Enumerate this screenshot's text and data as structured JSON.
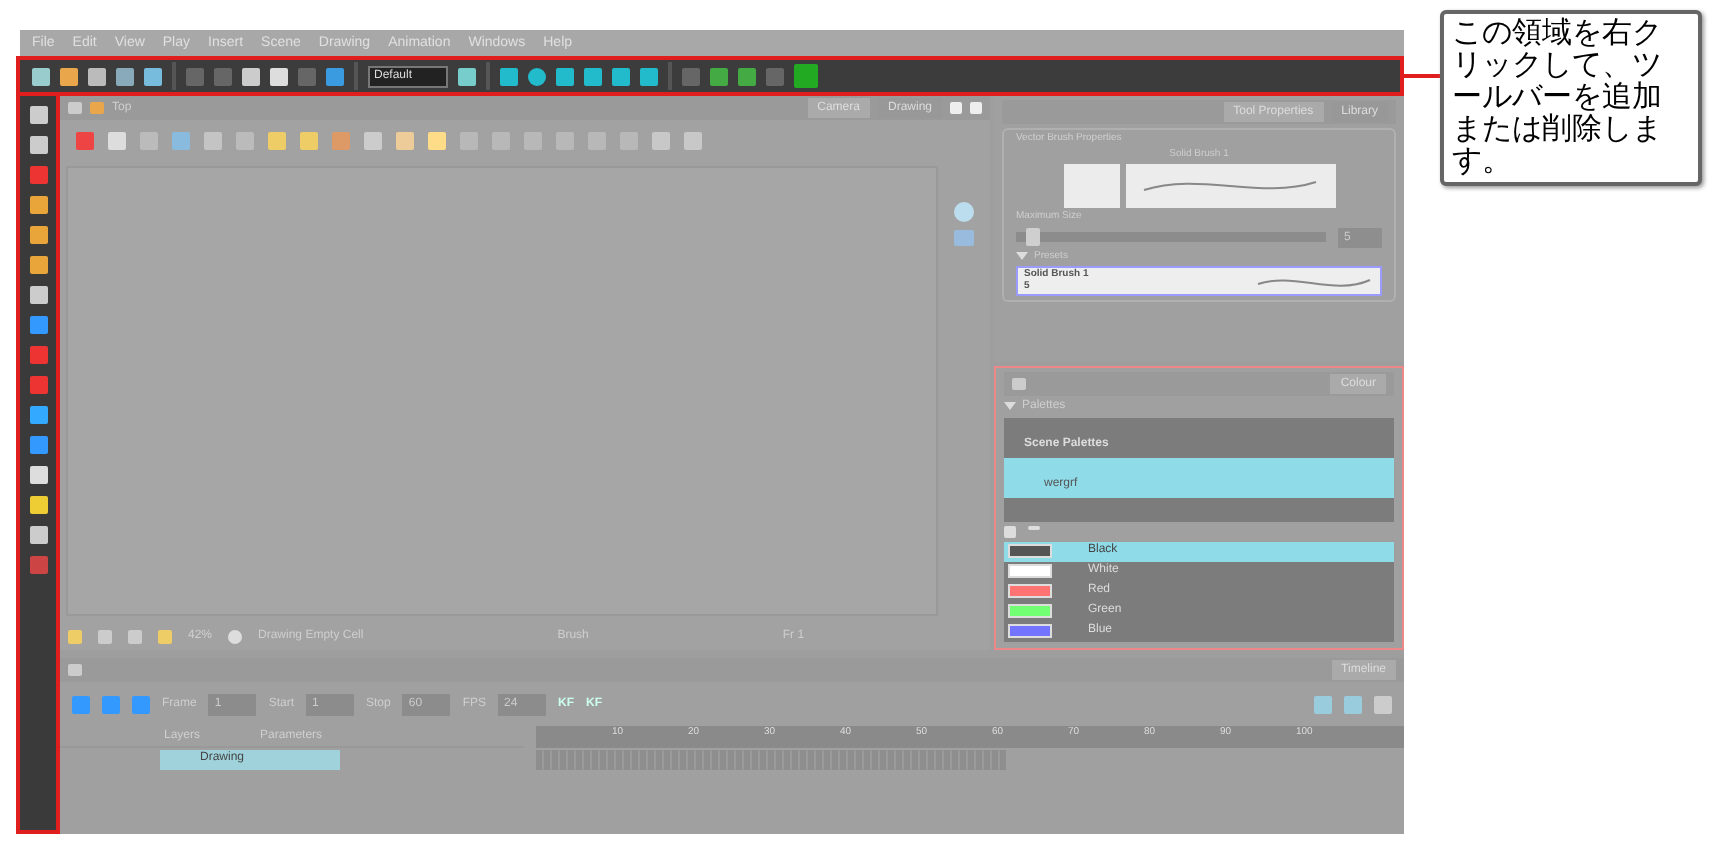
{
  "menu": [
    "File",
    "Edit",
    "View",
    "Play",
    "Insert",
    "Scene",
    "Drawing",
    "Animation",
    "Windows",
    "Help"
  ],
  "toolbar": {
    "style_value": "Default"
  },
  "camera": {
    "title": "Top",
    "tabs": [
      {
        "label": "Camera",
        "selected": true
      },
      {
        "label": "Drawing",
        "selected": false
      }
    ],
    "status": {
      "zoom": "42%",
      "cell": "Drawing Empty Cell",
      "tool": "Brush",
      "frame": "Fr 1"
    }
  },
  "tool_properties": {
    "tabs": [
      {
        "label": "Tool Properties",
        "selected": true
      },
      {
        "label": "Library",
        "selected": false
      }
    ],
    "group": "Vector Brush Properties",
    "brush_name": "Solid Brush 1",
    "size_label": "Maximum Size",
    "size": {
      "level": 0.03,
      "value": "5"
    },
    "presets_label": "Presets",
    "presets": [
      {
        "name": "Solid Brush 1",
        "size": "5",
        "selected": true
      }
    ]
  },
  "colour": {
    "tabs": [
      {
        "label": "Colour",
        "selected": true
      }
    ],
    "palettes_label": "Palettes",
    "palette_group": "Scene Palettes",
    "palettes": [
      {
        "name": "wergrf",
        "selected": true
      }
    ],
    "colours": [
      {
        "name": "Black",
        "color": "#555555",
        "selected": true
      },
      {
        "name": "White",
        "color": "#ffffff",
        "selected": false
      },
      {
        "name": "Red",
        "color": "#ff7373",
        "selected": false
      },
      {
        "name": "Green",
        "color": "#73ff73",
        "selected": false
      },
      {
        "name": "Blue",
        "color": "#7373ff",
        "selected": false
      }
    ]
  },
  "timeline": {
    "tab": "Timeline",
    "frame_label": "Frame",
    "frame": "1",
    "start_label": "Start",
    "start": "1",
    "stop_label": "Stop",
    "stop": "60",
    "fps_label": "FPS",
    "fps": "24",
    "kf_buttons": [
      "KF",
      "KF"
    ],
    "layers_label": "Layers",
    "parameters_label": "Parameters",
    "layers": [
      {
        "name": "Drawing",
        "selected": true
      }
    ],
    "ruler": [
      "10",
      "20",
      "30",
      "40",
      "50",
      "60",
      "70",
      "80",
      "90",
      "100"
    ]
  },
  "callout": "この領域を右クリックして、ツールバーを追加または削除します。"
}
